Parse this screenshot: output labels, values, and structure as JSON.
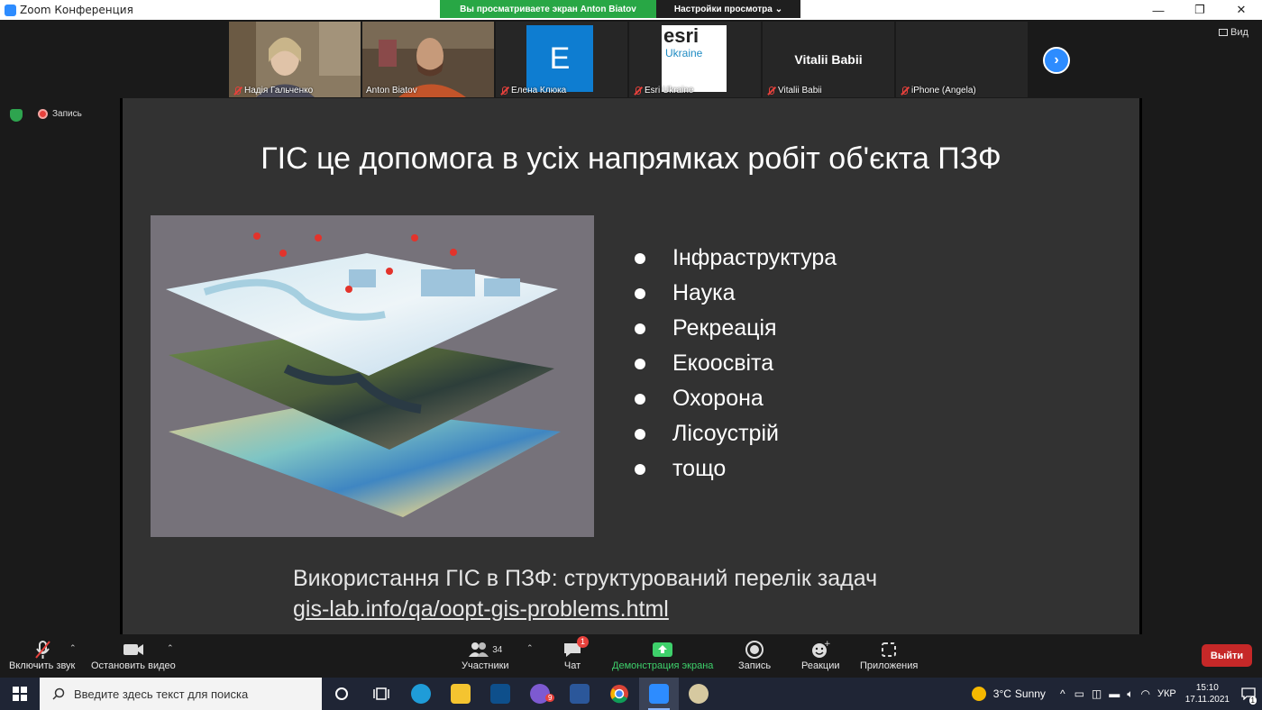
{
  "window": {
    "title": "Zoom Конференция"
  },
  "banner": {
    "sharing_text": "Вы просматриваете экран Anton Biatov",
    "view_options": "Настройки просмотра"
  },
  "gallery": {
    "participants": [
      {
        "name": "Надія Гальченко",
        "muted": true,
        "kind": "video"
      },
      {
        "name": "Anton Biatov",
        "muted": false,
        "kind": "video",
        "active": true
      },
      {
        "name": "Елена Клюка",
        "muted": true,
        "kind": "avatar",
        "avatar_letter": "E"
      },
      {
        "name": "Esri Ukraine",
        "muted": true,
        "kind": "logo",
        "logo_top": "esri",
        "logo_bottom": "Ukraine"
      },
      {
        "name": "Vitalii Babii",
        "muted": true,
        "kind": "name",
        "big_name": "Vitalii Babii"
      },
      {
        "name": "iPhone (Angela)",
        "muted": true,
        "kind": "blank"
      }
    ],
    "view_label": "Вид"
  },
  "status": {
    "recording_label": "Запись"
  },
  "slide": {
    "title": "ГІС це допомога в усіх напрямках робіт об'єкта ПЗФ",
    "bullets": [
      "Інфраструктура",
      "Наука",
      "Рекреація",
      "Екоосвіта",
      "Охорона",
      "Лісоустрій",
      "тощо"
    ],
    "subtitle": "Використання ГІС в ПЗФ: структурований перелік задач",
    "link": "gis-lab.info/qa/oopt-gis-problems.html"
  },
  "toolbar": {
    "audio_label": "Включить звук",
    "video_label": "Остановить видео",
    "participants_label": "Участники",
    "participants_count": "34",
    "chat_label": "Чат",
    "chat_badge": "1",
    "share_label": "Демонстрация экрана",
    "record_label": "Запись",
    "reactions_label": "Реакции",
    "apps_label": "Приложения",
    "leave_label": "Выйти"
  },
  "taskbar": {
    "search_placeholder": "Введите здесь текст для поиска",
    "viber_badge": "9",
    "weather_temp": "3°C",
    "weather_text": "Sunny",
    "language": "УКР",
    "time": "15:10",
    "date": "17.11.2021",
    "notification_count": "1"
  },
  "colors": {
    "accent": "#2d8cff",
    "share_green": "#28a745",
    "leave_red": "#c62828",
    "slide_bg": "#323232"
  }
}
